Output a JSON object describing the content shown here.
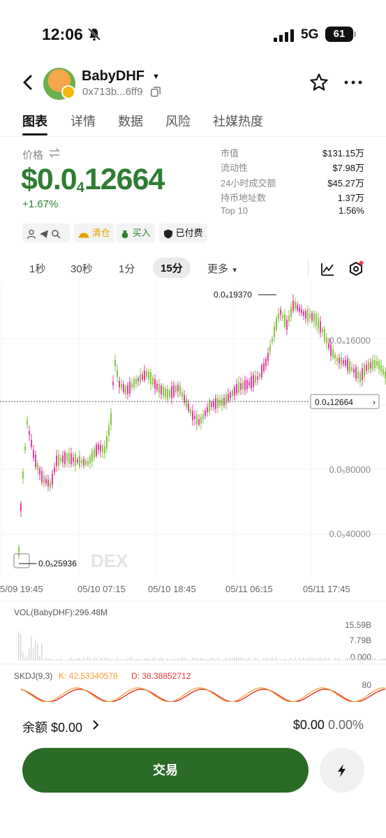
{
  "status": {
    "time": "12:06",
    "network": "5G",
    "battery": "61"
  },
  "header": {
    "token_name": "BabyDHF",
    "address": "0x713b...6ff9"
  },
  "tabs": [
    "图表",
    "详情",
    "数据",
    "风险",
    "社媒热度"
  ],
  "price": {
    "label": "价格",
    "main_prefix": "$0.0",
    "subscript": "4",
    "main_suffix": "12664",
    "change": "+1.67%"
  },
  "stats": [
    {
      "label": "市值",
      "value": "$131.15万"
    },
    {
      "label": "流动性",
      "value": "$7.98万"
    },
    {
      "label": "24小时成交额",
      "value": "$45.27万"
    },
    {
      "label": "持币地址数",
      "value": "1.37万"
    },
    {
      "label": "Top 10",
      "value": "1.56%"
    }
  ],
  "chips": {
    "clear": "清仓",
    "buy": "买入",
    "paid": "已付费"
  },
  "timeframes": [
    "1秒",
    "30秒",
    "1分",
    "15分",
    "更多"
  ],
  "chart_data": {
    "type": "candlestick",
    "interval": "15分",
    "x_ticks": [
      "5/09 19:45",
      "05/10 07:15",
      "05/10 18:45",
      "05/11 06:15",
      "05/11 17:45"
    ],
    "y_ticks": [
      "0.0₄16000",
      "0.0₅80000",
      "0.0₅40000"
    ],
    "high_label": "0.0₄19370",
    "low_label": "0.0₅25936",
    "current_label": "0.0₄12664",
    "watermark": "DEX",
    "volume_label": "VOL(BabyDHF):296.48M",
    "volume_ticks": [
      "15.59B",
      "7.79B",
      "0.000"
    ],
    "skdj_label": "SKDJ(9,3)",
    "skdj_k": "K: 42.53340578",
    "skdj_d": "D: 38.38852712",
    "skdj_tick": "80",
    "colors": {
      "up": "#8bc34a",
      "down": "#e040a0",
      "k": "#f0a030",
      "d": "#e53935"
    }
  },
  "balance": {
    "label": "余额 $0.00",
    "right_value": "$0.00",
    "right_pct": "0.00%"
  },
  "trade_button": "交易"
}
